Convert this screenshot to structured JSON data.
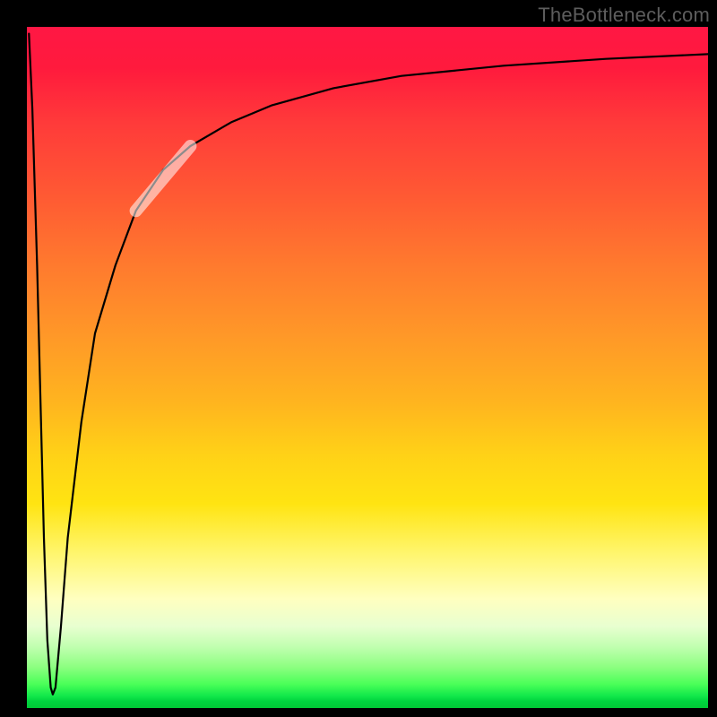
{
  "watermark": "TheBottleneck.com",
  "chart_data": {
    "type": "line",
    "title": "",
    "xlabel": "",
    "ylabel": "",
    "xlim": [
      0,
      100
    ],
    "ylim": [
      0,
      100
    ],
    "grid": false,
    "series": [
      {
        "name": "curve",
        "x": [
          0.3,
          0.8,
          1.5,
          2.5,
          3.0,
          3.5,
          3.8,
          4.2,
          5.0,
          6.0,
          8.0,
          10.0,
          13.0,
          16.0,
          20.0,
          24.0,
          30.0,
          36.0,
          45.0,
          55.0,
          70.0,
          85.0,
          100.0
        ],
        "y": [
          99.0,
          88.0,
          65.0,
          25.0,
          10.0,
          3.0,
          2.0,
          3.0,
          12.0,
          25.0,
          42.0,
          55.0,
          65.0,
          73.0,
          79.0,
          82.5,
          86.0,
          88.5,
          91.0,
          92.8,
          94.3,
          95.3,
          96.0
        ]
      }
    ],
    "highlight_segment": {
      "x_start": 16.0,
      "x_end": 24.0
    },
    "colors": {
      "curve": "#000000",
      "highlight": "rgba(255,255,255,0.55)",
      "gradient_top": "#ff1744",
      "gradient_mid": "#ffd217",
      "gradient_bottom": "#00c936"
    }
  }
}
